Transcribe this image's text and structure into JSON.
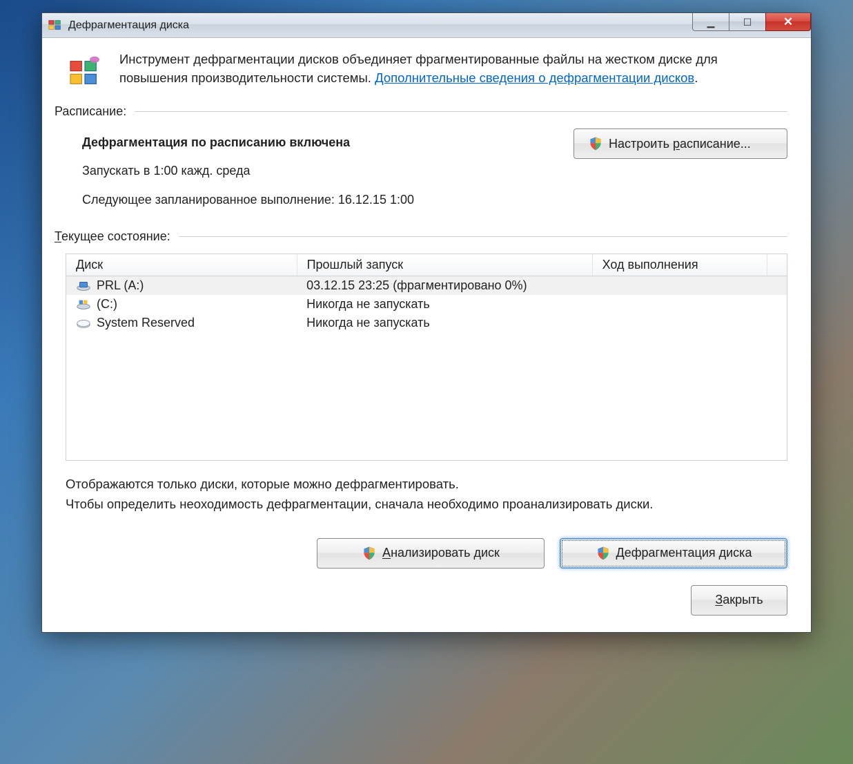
{
  "window": {
    "title": "Дефрагментация диска"
  },
  "intro": {
    "text_before_link": "Инструмент дефрагментации дисков объединяет фрагментированные файлы на жестком диске для повышения производительности системы. ",
    "link_text": "Дополнительные сведения о дефрагментации дисков",
    "period": "."
  },
  "sections": {
    "schedule_label": "Расписание:",
    "status_label": "Текущее состояние:"
  },
  "schedule": {
    "enabled_text": "Дефрагментация по расписанию включена",
    "run_text": "Запускать в 1:00 кажд. среда",
    "next_text": "Следующее запланированное выполнение: 16.12.15 1:00",
    "configure_btn_prefix": "Настроить ",
    "configure_btn_underlined": "р",
    "configure_btn_suffix": "асписание..."
  },
  "table": {
    "col_disk": "Диск",
    "col_lastrun": "Прошлый запуск",
    "col_progress": "Ход выполнения",
    "rows": [
      {
        "icon": "drive-ext",
        "name": "PRL (A:)",
        "lastrun": "03.12.15 23:25 (фрагментировано 0%)",
        "progress": "",
        "selected": true
      },
      {
        "icon": "drive-sys",
        "name": "(C:)",
        "lastrun": "Никогда не запускать",
        "progress": "",
        "selected": false
      },
      {
        "icon": "drive-plain",
        "name": "System Reserved",
        "lastrun": "Никогда не запускать",
        "progress": "",
        "selected": false
      }
    ]
  },
  "footer": {
    "line1": "Отображаются только диски, которые можно дефрагментировать.",
    "line2": "Чтобы определить неоходимость  дефрагментации, сначала необходимо проанализировать диски."
  },
  "buttons": {
    "analyze_u": "А",
    "analyze_rest": "нализировать диск",
    "defrag_u": "Д",
    "defrag_rest": "ефрагментация диска",
    "close_u": "З",
    "close_rest": "акрыть"
  }
}
